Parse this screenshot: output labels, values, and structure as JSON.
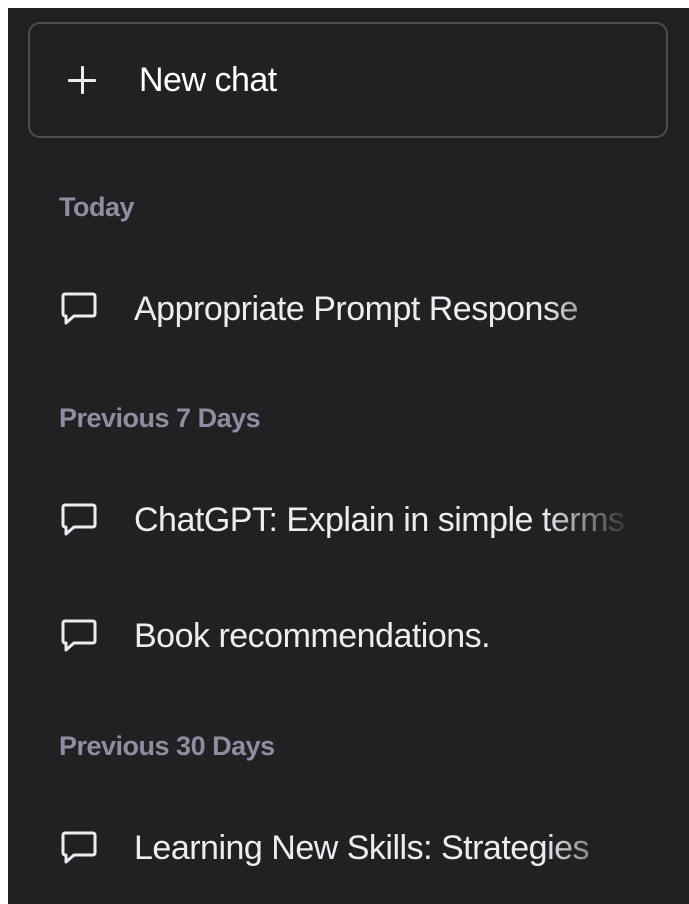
{
  "new_chat": {
    "icon": "plus-icon",
    "label": "New chat"
  },
  "sections": [
    {
      "label": "Today",
      "chats": [
        {
          "icon": "chat-bubble-icon",
          "title": "Appropriate Prompt Response"
        }
      ]
    },
    {
      "label": "Previous 7 Days",
      "chats": [
        {
          "icon": "chat-bubble-icon",
          "title": "ChatGPT: Explain in simple terms"
        },
        {
          "icon": "chat-bubble-icon",
          "title": "Book recommendations."
        }
      ]
    },
    {
      "label": "Previous 30 Days",
      "chats": [
        {
          "icon": "chat-bubble-icon",
          "title": "Learning New Skills: Strategies"
        }
      ]
    }
  ],
  "colors": {
    "sidebar_bg": "#202123",
    "border": "#4d4d4f",
    "text": "#ececf1",
    "section_label": "#8e8ea0"
  }
}
